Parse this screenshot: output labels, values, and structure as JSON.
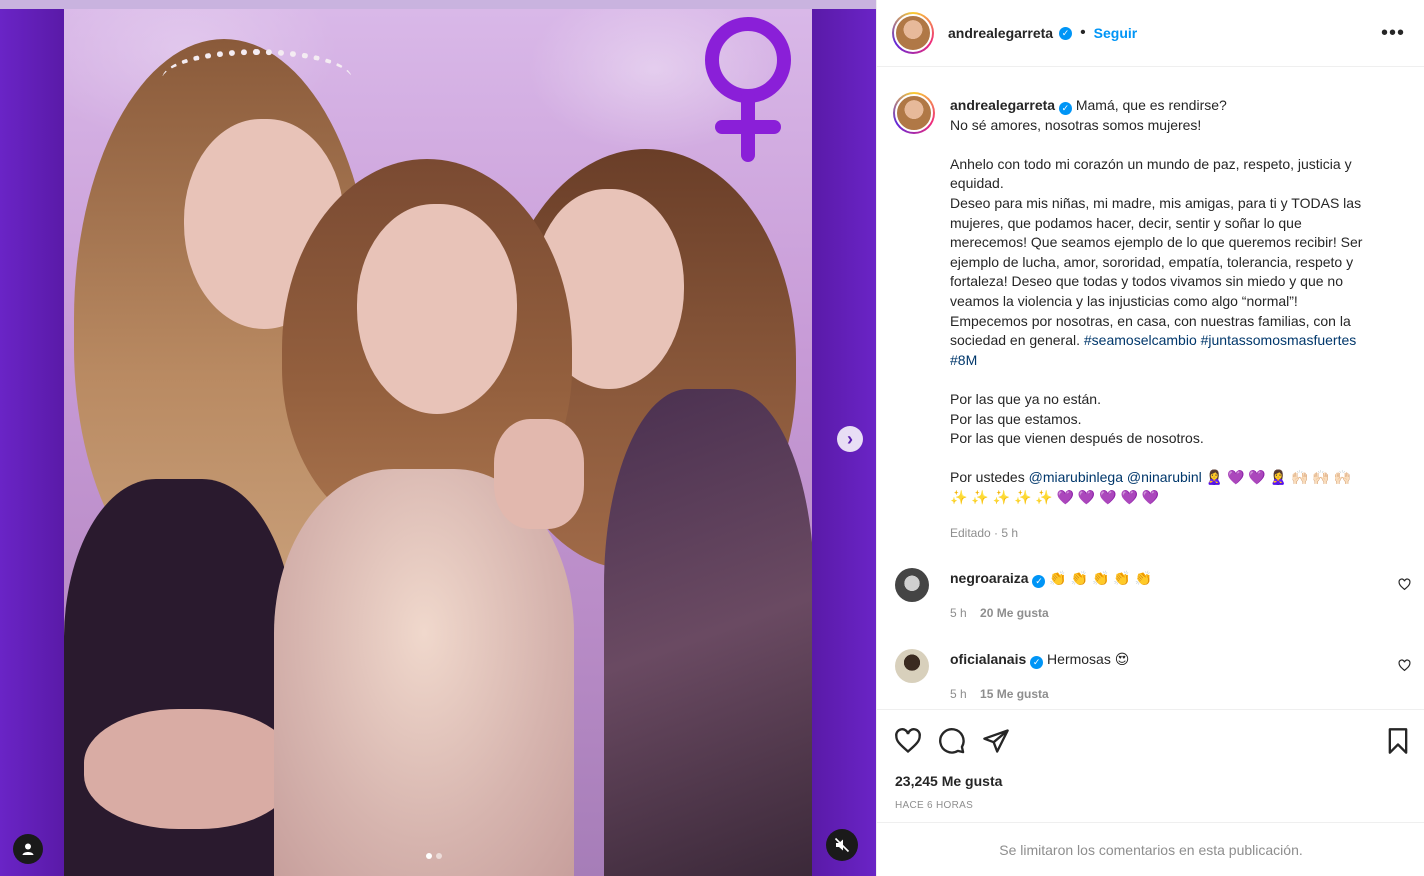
{
  "post": {
    "username": "andrealegarreta",
    "verified_icon": "verified-badge-icon",
    "separator": "•",
    "follow_label": "Seguir",
    "more_icon": "more-options-icon",
    "more_glyph": "•••"
  },
  "caption": {
    "username": "andrealegarreta",
    "lines": [
      "Mamá, que es rendirse?",
      "No sé amores, nosotras somos mujeres!",
      "",
      "Anhelo con todo mi corazón un mundo de paz, respeto, justicia y",
      "equidad.",
      "Deseo para mis niñas, mi madre, mis amigas, para ti y TODAS las",
      "mujeres, que podamos hacer, decir, sentir y soñar lo que",
      "merecemos! Que seamos ejemplo de lo que queremos recibir! Ser",
      "ejemplo de lucha, amor, sororidad, empatía, tolerancia, respeto y",
      "fortaleza! Deseo que todas y todos vivamos sin miedo y que no",
      "veamos la violencia y las injusticias como algo “normal”!",
      "Empecemos por nosotras, en casa, con nuestras familias, con la"
    ],
    "line_sociedad": "sociedad en general.",
    "hashtag_1": "#seamoselcambio",
    "hashtag_2": "#juntassomosmasfuertes",
    "hashtag_3": "#8M",
    "lines_2": [
      "Por las que ya no están.",
      "Por las que estamos.",
      "Por las que vienen después de nosotros."
    ],
    "por_ustedes": "Por ustedes",
    "mention_1": "@miarubinlega",
    "mention_2": "@ninarubinl",
    "emoji_line_1": "🙎‍♀️ 💜 💜 🙎‍♀️ 🙌🏻 🙌🏻 🙌🏻",
    "emoji_line_2": "✨ ✨ ✨ ✨ ✨ 💜 💜 💜 💜 💜",
    "edited": "Editado · 5 h"
  },
  "comments": [
    {
      "username": "negroaraiza",
      "text": "👏 👏 👏 👏 👏",
      "time": "5 h",
      "likes": "20 Me gusta"
    },
    {
      "username": "oficialanais",
      "text": "Hermosas 😍",
      "time": "5 h",
      "likes": "15 Me gusta"
    }
  ],
  "actions": {
    "like_icon": "heart-icon",
    "comment_icon": "comment-icon",
    "share_icon": "share-icon",
    "save_icon": "bookmark-icon",
    "likes": "23,245 Me gusta",
    "time_ago": "HACE 6 HORAS"
  },
  "footer": {
    "comments_limited": "Se limitaron los comentarios en esta publicación."
  },
  "media": {
    "next_icon": "chevron-right-icon",
    "next_glyph": "›",
    "user_icon": "user-tag-icon",
    "mute_icon": "audio-muted-icon",
    "carousel_index": 1,
    "carousel_total": 2
  },
  "colors": {
    "accent": "#0095f6",
    "hashtag": "#00376b",
    "purple_band": "#5a1fae",
    "venus": "#8a1fd8"
  }
}
